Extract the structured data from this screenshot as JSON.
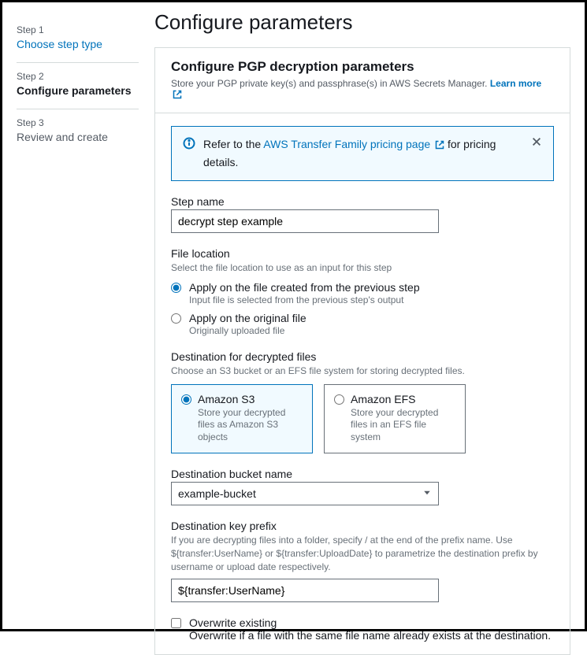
{
  "sidebar": {
    "steps": [
      {
        "label": "Step 1",
        "name": "Choose step type"
      },
      {
        "label": "Step 2",
        "name": "Configure parameters"
      },
      {
        "label": "Step 3",
        "name": "Review and create"
      }
    ]
  },
  "page_title": "Configure parameters",
  "panel": {
    "title": "Configure PGP decryption parameters",
    "subtitle_pre": "Store your PGP private key(s) and passphrase(s) in AWS Secrets Manager. ",
    "learn_more": "Learn more"
  },
  "alert": {
    "pre": "Refer to the ",
    "link": "AWS Transfer Family pricing page",
    "post": " for pricing details."
  },
  "step_name": {
    "label": "Step name",
    "value": "decrypt step example"
  },
  "file_location": {
    "label": "File location",
    "desc": "Select the file location to use as an input for this step",
    "opt1": {
      "label": "Apply on the file created from the previous step",
      "desc": "Input file is selected from the previous step's output"
    },
    "opt2": {
      "label": "Apply on the original file",
      "desc": "Originally uploaded file"
    }
  },
  "destination": {
    "label": "Destination for decrypted files",
    "desc": "Choose an S3 bucket or an EFS file system for storing decrypted files.",
    "s3": {
      "label": "Amazon S3",
      "desc": "Store your decrypted files as Amazon S3 objects"
    },
    "efs": {
      "label": "Amazon EFS",
      "desc": "Store your decrypted files in an EFS file system"
    }
  },
  "bucket": {
    "label": "Destination bucket name",
    "value": "example-bucket"
  },
  "key_prefix": {
    "label": "Destination key prefix",
    "desc": "If you are decrypting files into a folder, specify / at the end of the prefix name. Use ${transfer:UserName} or ${transfer:UploadDate} to parametrize the destination prefix by username or upload date respectively.",
    "value": "${transfer:UserName}"
  },
  "overwrite": {
    "label": "Overwrite existing",
    "desc": "Overwrite if a file with the same file name already exists at the destination."
  }
}
